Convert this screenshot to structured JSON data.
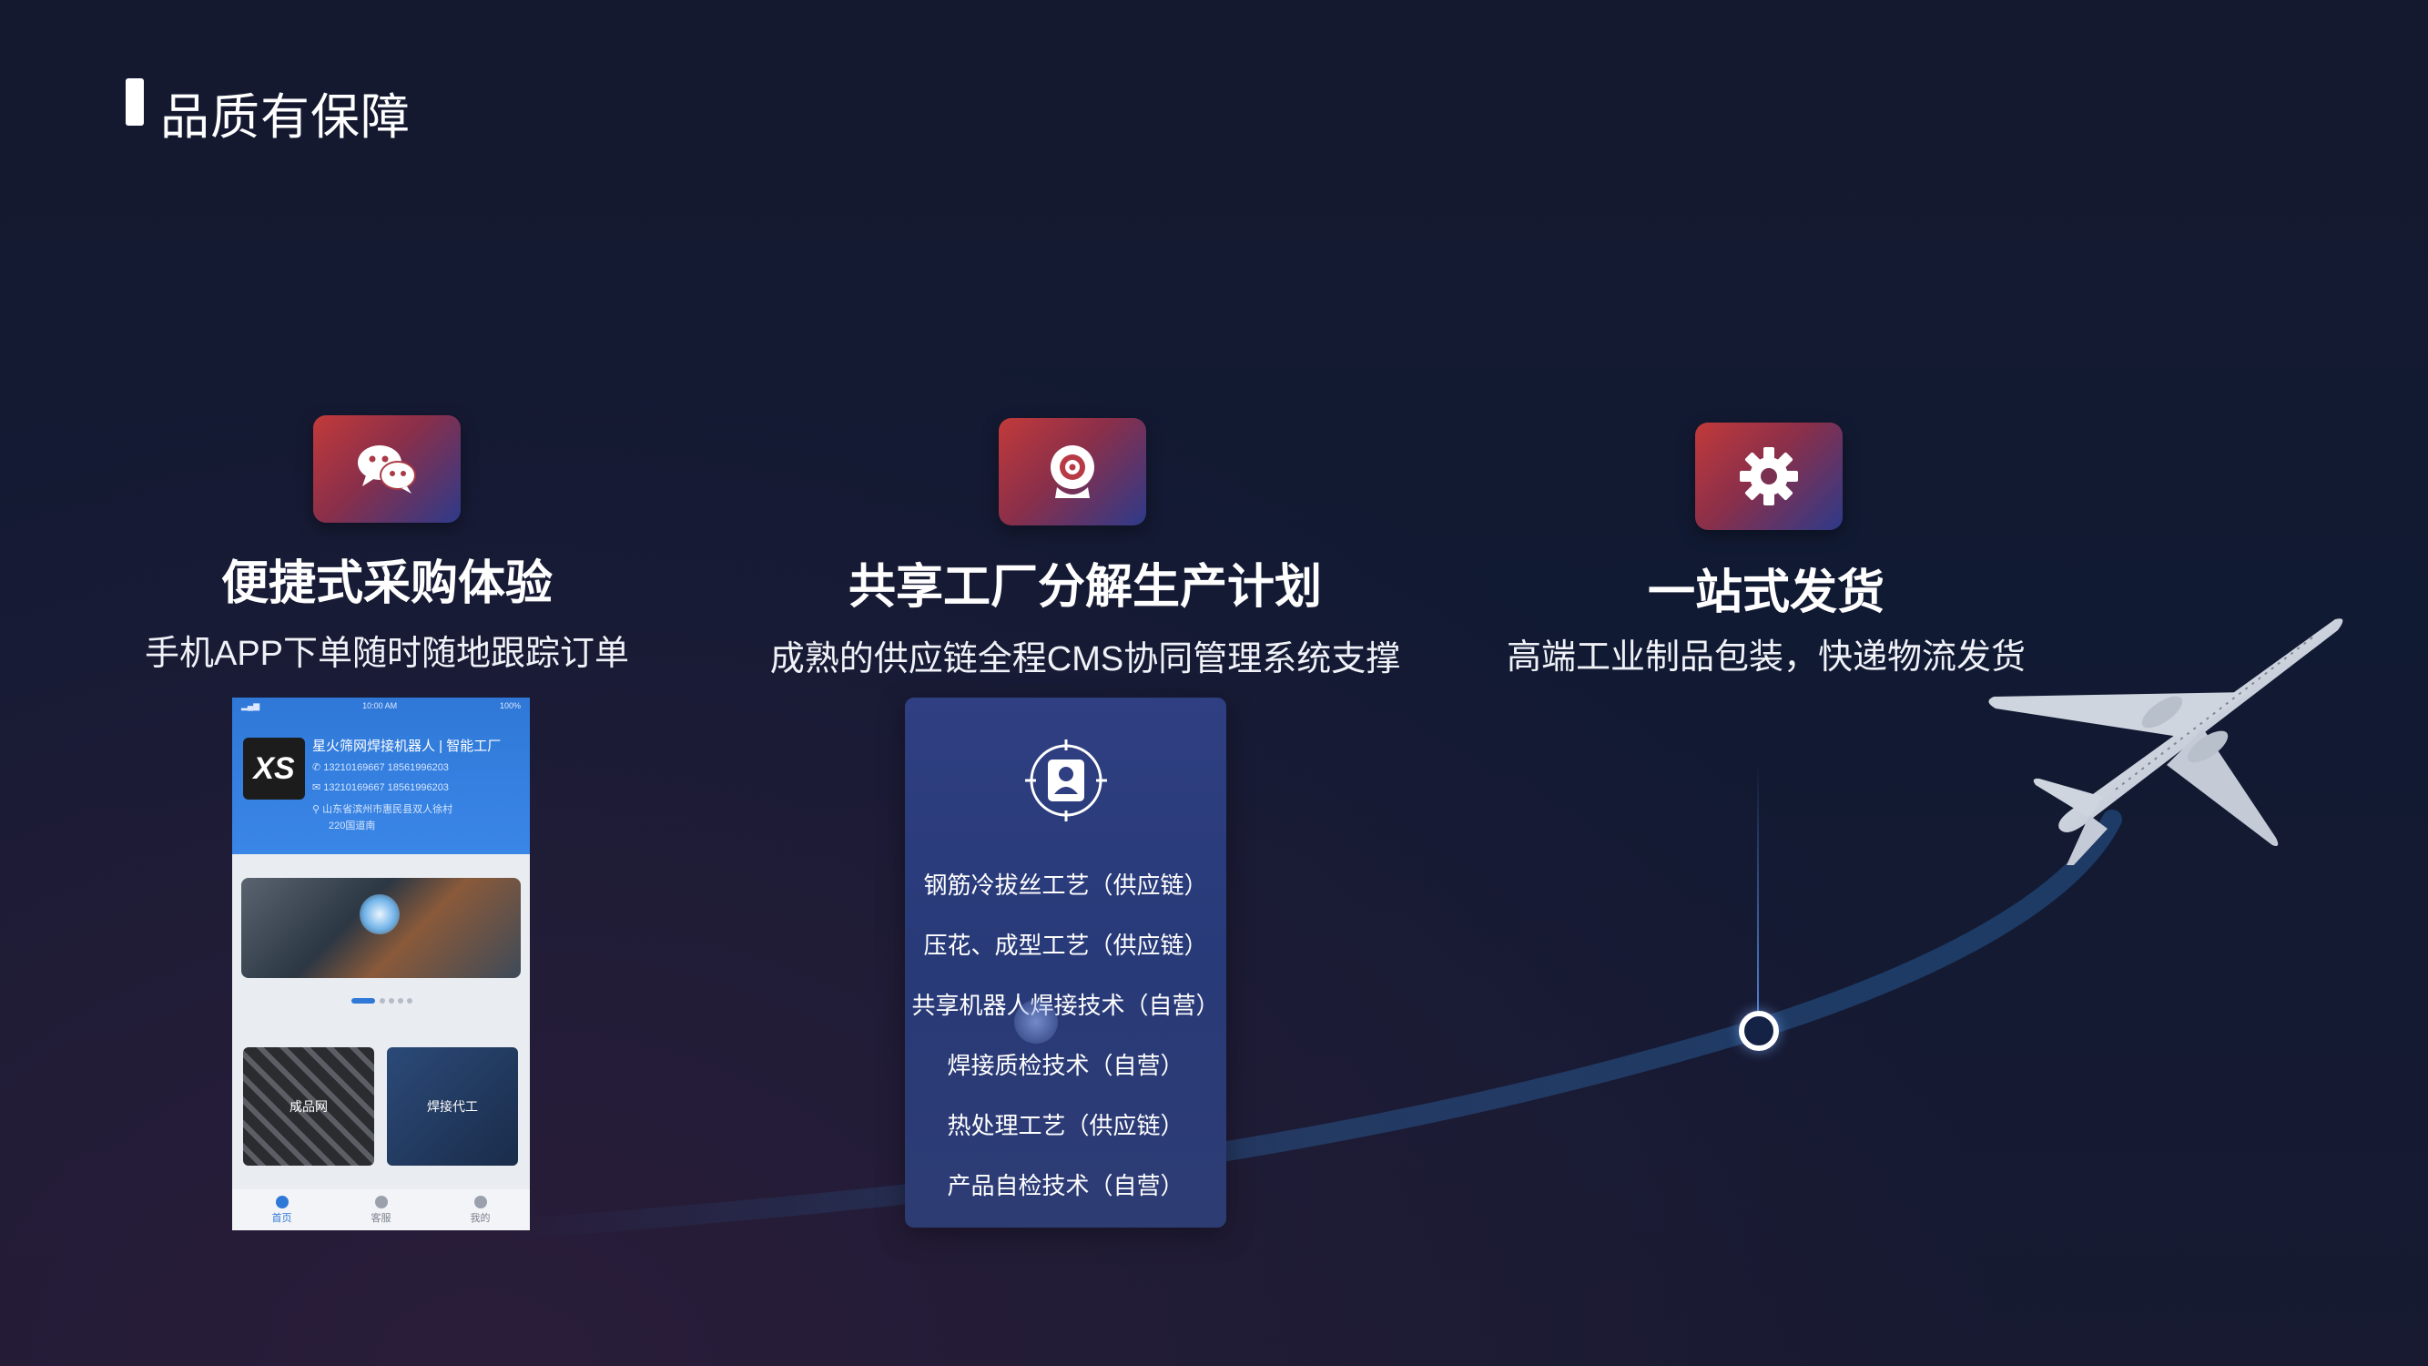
{
  "page": {
    "title": "品质有保障"
  },
  "features": [
    {
      "icon": "wechat-icon",
      "title": "便捷式采购体验",
      "subtitle": "手机APP下单随时随地跟踪订单"
    },
    {
      "icon": "webcam-icon",
      "title": "共享工厂分解生产计划",
      "subtitle": "成熟的供应链全程CMS协同管理系统支撑"
    },
    {
      "icon": "gear-icon",
      "title": "一站式发货",
      "subtitle": "高端工业制品包装，快递物流发货"
    }
  ],
  "phone": {
    "status_time": "10:00 AM",
    "status_battery": "100%",
    "logo": "XS",
    "company": "星火筛网焊接机器人 | 智能工厂",
    "phone_line": "13210169667  18561996203",
    "message_line": "13210169667  18561996203",
    "address": "山东省滨州市惠民县双人徐村",
    "address2": "220国道南",
    "tile_left": "成品网",
    "tile_right": "焊接代工",
    "tabs": [
      "首页",
      "客服",
      "我的"
    ]
  },
  "capabilities": {
    "icon": "user-target-icon",
    "items": [
      "钢筋冷拔丝工艺（供应链）",
      "压花、成型工艺（供应链）",
      "共享机器人焊接技术（自营）",
      "焊接质检技术（自营）",
      "热处理工艺（供应链）",
      "产品自检技术（自营）"
    ]
  },
  "colors": {
    "icon_gradient_start": "#c23a3a",
    "icon_gradient_end": "#2d3a8a",
    "card_bg": "#2f3f82",
    "background": "#15192f"
  }
}
